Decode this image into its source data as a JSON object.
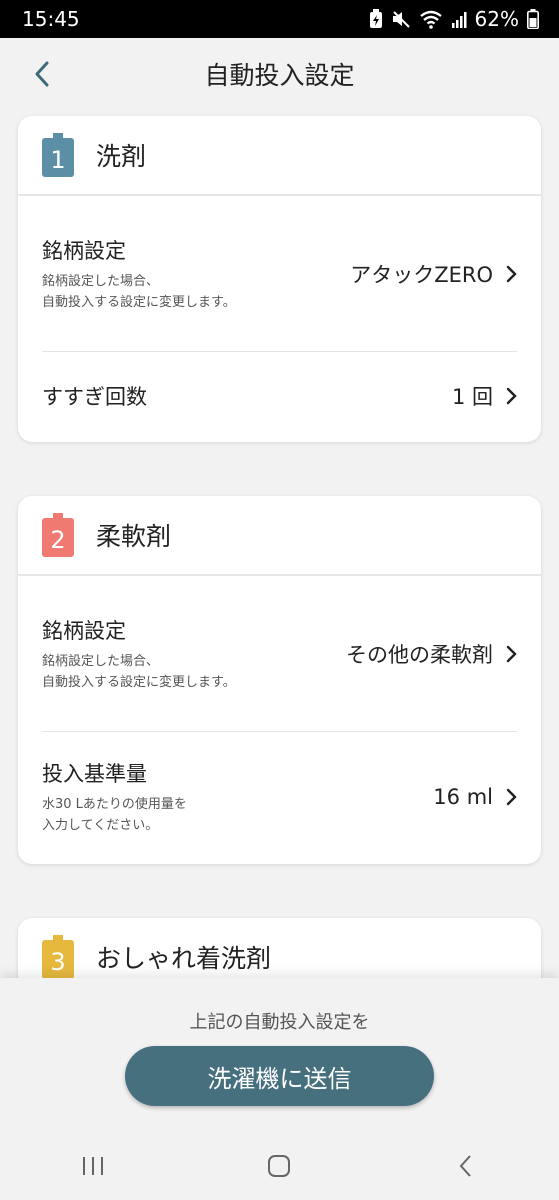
{
  "status_bar": {
    "time": "15:45",
    "battery": "62%"
  },
  "header": {
    "title": "自動投入設定"
  },
  "colors": {
    "detergent": "#5a8fa6",
    "softener": "#ef7a72",
    "fashion": "#e6b93e",
    "button": "#47707f"
  },
  "cards": [
    {
      "number": "1",
      "title": "洗剤",
      "rows": [
        {
          "label": "銘柄設定",
          "desc_1": "銘柄設定した場合、",
          "desc_2": "自動投入する設定に変更します。",
          "value": "アタックZERO"
        },
        {
          "label": "すすぎ回数",
          "value": "1 回"
        }
      ]
    },
    {
      "number": "2",
      "title": "柔軟剤",
      "rows": [
        {
          "label": "銘柄設定",
          "desc_1": "銘柄設定した場合、",
          "desc_2": "自動投入する設定に変更します。",
          "value": "その他の柔軟剤"
        },
        {
          "label": "投入基準量",
          "desc_1": "水30 Lあたりの使用量を",
          "desc_2": "入力してください。",
          "value": "16 ml"
        }
      ]
    },
    {
      "number": "3",
      "title": "おしゃれ着洗剤"
    }
  ],
  "bottom": {
    "caption": "上記の自動投入設定を",
    "send_label": "洗濯機に送信"
  }
}
